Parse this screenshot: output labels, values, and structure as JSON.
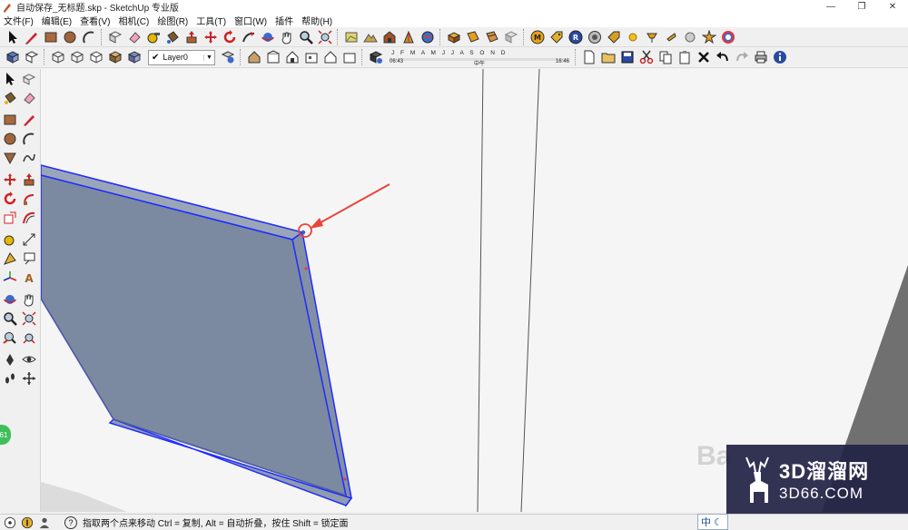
{
  "window": {
    "title": "自动保存_无标题.skp - SketchUp 专业版",
    "controls": [
      "—",
      "❐",
      "✕"
    ]
  },
  "menu": [
    "文件(F)",
    "编辑(E)",
    "查看(V)",
    "相机(C)",
    "绘图(R)",
    "工具(T)",
    "窗口(W)",
    "插件",
    "帮助(H)"
  ],
  "layers": {
    "current": "Layer0",
    "check": "✔"
  },
  "shadow": {
    "months": "J F M A M J J A S O N D",
    "time_start": "06:43",
    "time_mid": "中午",
    "time_end": "16:46"
  },
  "status": {
    "hint": "指取两个点来移动 Ctrl = 复制, Alt = 自动折叠，按住 Shift = 锁定面",
    "help": "?"
  },
  "ime": {
    "label": "中"
  },
  "badge": {
    "count": "61"
  },
  "watermark": {
    "title": "3D溜溜网",
    "sub": "3D66.COM",
    "ghost": "Ba"
  },
  "colors": {
    "panel_face": "#7b8aa0",
    "panel_edge": "#1f2bff",
    "arrow": "#e8443a",
    "viewport_bg": "#f5f5f5"
  }
}
